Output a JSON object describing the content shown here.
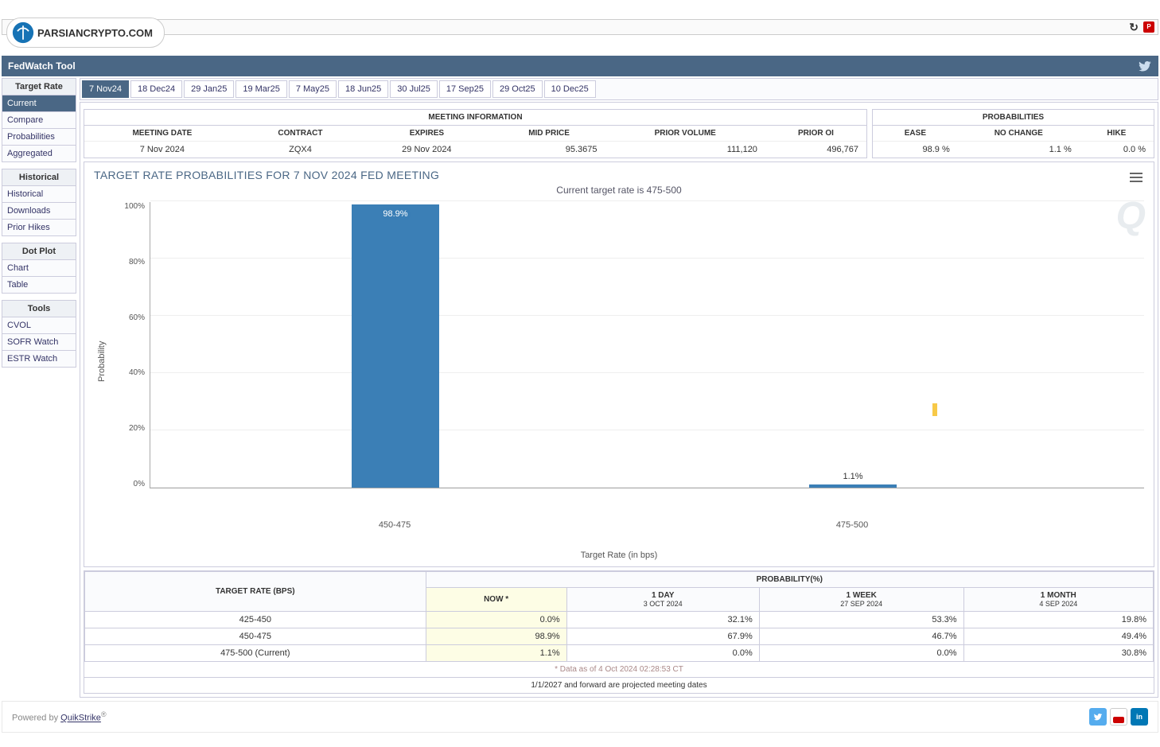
{
  "brand": "PARSIANCRYPTO.COM",
  "app_title": "FedWatch Tool",
  "sidebar": {
    "groups": [
      {
        "head": "Target Rate",
        "items": [
          "Current",
          "Compare",
          "Probabilities",
          "Aggregated"
        ],
        "active": 0
      },
      {
        "head": "Historical",
        "items": [
          "Historical",
          "Downloads",
          "Prior Hikes"
        ],
        "active": -1
      },
      {
        "head": "Dot Plot",
        "items": [
          "Chart",
          "Table"
        ],
        "active": -1
      },
      {
        "head": "Tools",
        "items": [
          "CVOL",
          "SOFR Watch",
          "ESTR Watch"
        ],
        "active": -1
      }
    ]
  },
  "tabs": [
    "7 Nov24",
    "18 Dec24",
    "29 Jan25",
    "19 Mar25",
    "7 May25",
    "18 Jun25",
    "30 Jul25",
    "17 Sep25",
    "29 Oct25",
    "10 Dec25"
  ],
  "active_tab": 0,
  "meeting_info": {
    "title": "MEETING INFORMATION",
    "headers": [
      "MEETING DATE",
      "CONTRACT",
      "EXPIRES",
      "MID PRICE",
      "PRIOR VOLUME",
      "PRIOR OI"
    ],
    "row": [
      "7 Nov 2024",
      "ZQX4",
      "29 Nov 2024",
      "95.3675",
      "111,120",
      "496,767"
    ]
  },
  "probabilities": {
    "title": "PROBABILITIES",
    "headers": [
      "EASE",
      "NO CHANGE",
      "HIKE"
    ],
    "row": [
      "98.9 %",
      "1.1 %",
      "0.0 %"
    ]
  },
  "chart_title": "TARGET RATE PROBABILITIES FOR 7 NOV 2024 FED MEETING",
  "chart_sub": "Current target rate is 475-500",
  "chart_x": "Target Rate (in bps)",
  "chart_y": "Probability",
  "chart_data": {
    "type": "bar",
    "categories": [
      "450-475",
      "475-500"
    ],
    "values": [
      98.9,
      1.1
    ],
    "labels": [
      "98.9%",
      "1.1%"
    ],
    "title": "TARGET RATE PROBABILITIES FOR 7 NOV 2024 FED MEETING",
    "xlabel": "Target Rate (in bps)",
    "ylabel": "Probability",
    "ylim": [
      0,
      100
    ],
    "yticks": [
      "0%",
      "20%",
      "40%",
      "60%",
      "80%",
      "100%"
    ]
  },
  "prob_table": {
    "row_head": "TARGET RATE (BPS)",
    "col_head": "PROBABILITY(%)",
    "cols": [
      {
        "top": "NOW *",
        "sub": ""
      },
      {
        "top": "1 DAY",
        "sub": "3 OCT 2024"
      },
      {
        "top": "1 WEEK",
        "sub": "27 SEP 2024"
      },
      {
        "top": "1 MONTH",
        "sub": "4 SEP 2024"
      }
    ],
    "rows": [
      {
        "rate": "425-450",
        "vals": [
          "0.0%",
          "32.1%",
          "53.3%",
          "19.8%"
        ]
      },
      {
        "rate": "450-475",
        "vals": [
          "98.9%",
          "67.9%",
          "46.7%",
          "49.4%"
        ]
      },
      {
        "rate": "475-500 (Current)",
        "vals": [
          "1.1%",
          "0.0%",
          "0.0%",
          "30.8%"
        ]
      }
    ]
  },
  "footnote": "* Data as of 4 Oct 2024 02:28:53 CT",
  "footnote2": "1/1/2027 and forward are projected meeting dates",
  "powered_prefix": "Powered by ",
  "powered_brand": "QuikStrike",
  "powered_sup": "®"
}
